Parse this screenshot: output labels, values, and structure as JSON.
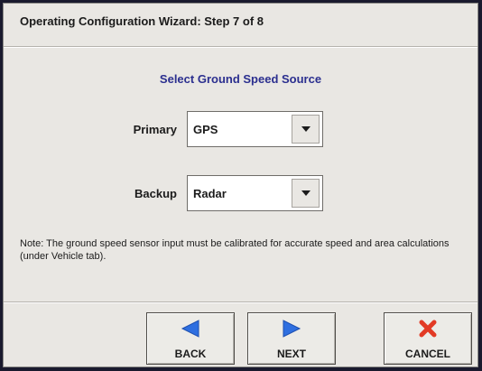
{
  "window": {
    "title": "Operating Configuration Wizard:  Step 7 of 8"
  },
  "heading": "Select Ground Speed Source",
  "primary": {
    "label": "Primary",
    "value": "GPS"
  },
  "backup": {
    "label": "Backup",
    "value": "Radar"
  },
  "note": "Note:  The ground speed sensor input must be calibrated for accurate speed and area calculations (under Vehicle tab).",
  "buttons": {
    "back": {
      "label": "BACK",
      "icon": "left-arrow-icon"
    },
    "next": {
      "label": "NEXT",
      "icon": "right-arrow-icon"
    },
    "cancel": {
      "label": "CANCEL",
      "icon": "red-x-icon"
    }
  },
  "colors": {
    "heading_text": "#2b2f8f",
    "arrow_icon": "#2f6fe0",
    "cancel_icon": "#e23a25"
  }
}
